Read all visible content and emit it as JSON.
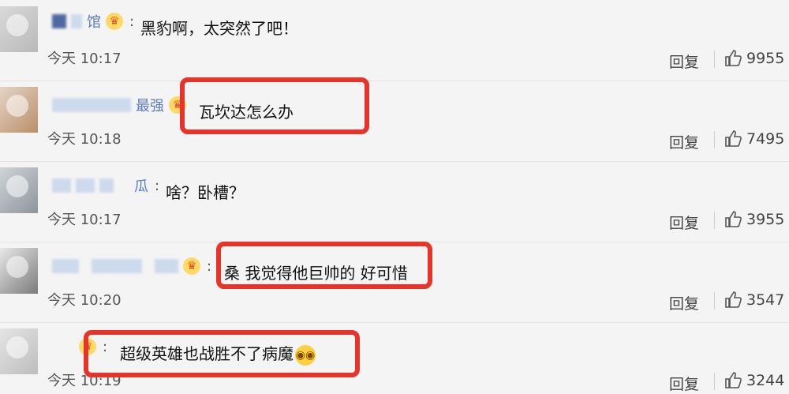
{
  "comments": [
    {
      "user": "馆",
      "text": "黑豹啊，太突然了吧！",
      "time": "今天 10:17",
      "reply": "回复",
      "likes": "9955"
    },
    {
      "user": "最强",
      "text": "瓦坎达怎么办",
      "time": "今天 10:18",
      "reply": "回复",
      "likes": "7495"
    },
    {
      "user": "瓜",
      "text": "啥？卧槽？",
      "time": "今天 10:17",
      "reply": "回复",
      "likes": "3955"
    },
    {
      "user": "",
      "text": "桑 我觉得他巨帅的 好可惜",
      "time": "今天 10:20",
      "reply": "回复",
      "likes": "3547"
    },
    {
      "user": "",
      "text": "超级英雄也战胜不了病魔",
      "time": "今天 10:19",
      "reply": "回复",
      "likes": "3244"
    }
  ],
  "colors": {
    "highlight": "#e8332a",
    "background": "#f4f4f4"
  },
  "icons": {
    "like": "thumbs-up-icon",
    "vip": "crown-icon",
    "emoji": "flushed-face-icon"
  }
}
